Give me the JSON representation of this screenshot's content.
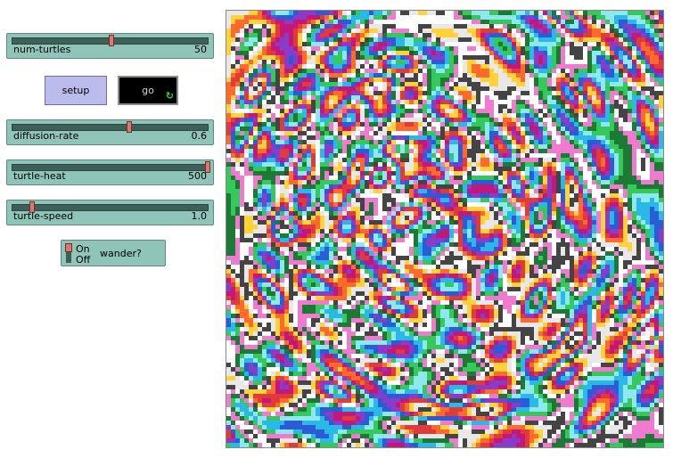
{
  "sliders": [
    {
      "label": "num-turtles",
      "value": "50",
      "fraction": 0.505
    },
    {
      "label": "diffusion-rate",
      "value": "0.6",
      "fraction": 0.6
    },
    {
      "label": "turtle-heat",
      "value": "500",
      "fraction": 1.0
    },
    {
      "label": "turtle-speed",
      "value": "1.0",
      "fraction": 0.1
    }
  ],
  "buttons": {
    "setup": "setup",
    "go": "go",
    "go_forever_icon": "forever-arrows-icon"
  },
  "switch": {
    "on_label": "On",
    "off_label": "Off",
    "name": "wander?",
    "state": "on"
  },
  "view": {
    "palette": [
      "#e8e8e8",
      "#ffd23a",
      "#ff6a2b",
      "#e03b3b",
      "#c2187a",
      "#8a3cc8",
      "#2c5bd6",
      "#2ab8e8",
      "#8fe8f0",
      "#35c85a",
      "#1c7a35",
      "#f07ad0",
      "#ffffff",
      "#444444"
    ]
  }
}
